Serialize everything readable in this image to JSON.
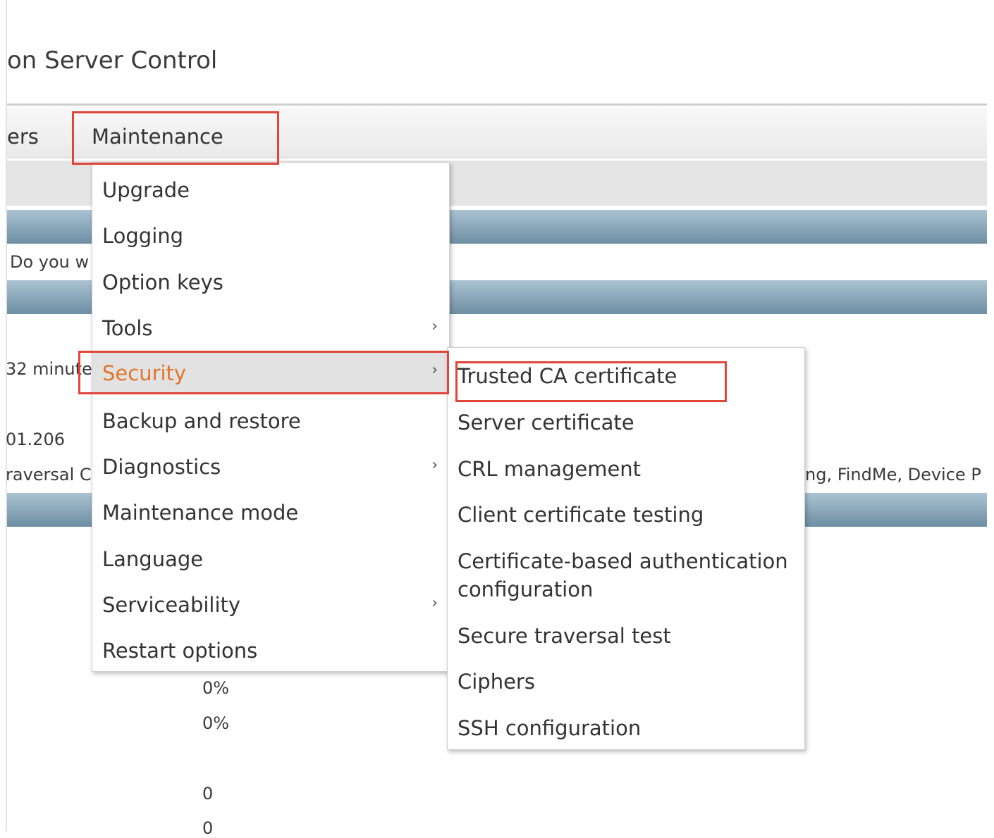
{
  "header": {
    "title": "on Server Control"
  },
  "nav": {
    "users_label": "ers",
    "maintenance_label": "Maintenance"
  },
  "background": {
    "notice_text": "Do you w",
    "uptime_text": "32 minute",
    "address_text": "01.206",
    "options_left_text": "raversal C",
    "options_right_text": "ng, FindMe, Device P",
    "stat_1": "0%",
    "stat_2": "0%",
    "stat_3": "0",
    "stat_4": "0"
  },
  "maintenance_menu": {
    "items": [
      {
        "label": "Upgrade"
      },
      {
        "label": "Logging"
      },
      {
        "label": "Option keys"
      },
      {
        "label": "Tools",
        "chevron": "›"
      },
      {
        "label": "Security",
        "chevron": "›"
      },
      {
        "label": "Backup and restore"
      },
      {
        "label": "Diagnostics",
        "chevron": "›"
      },
      {
        "label": "Maintenance mode"
      },
      {
        "label": "Language"
      },
      {
        "label": "Serviceability",
        "chevron": "›"
      },
      {
        "label": "Restart options"
      }
    ]
  },
  "security_submenu": {
    "items": [
      {
        "label": "Trusted CA certificate"
      },
      {
        "label": "Server certificate"
      },
      {
        "label": "CRL management"
      },
      {
        "label": "Client certificate testing"
      },
      {
        "label": "Certificate-based authentication configuration"
      },
      {
        "label": "Secure traversal test"
      },
      {
        "label": "Ciphers"
      },
      {
        "label": "SSH configuration"
      }
    ]
  },
  "colors": {
    "highlight": "#e0453a",
    "active_item_text": "#e4742a",
    "band": "#7d9bb0"
  }
}
